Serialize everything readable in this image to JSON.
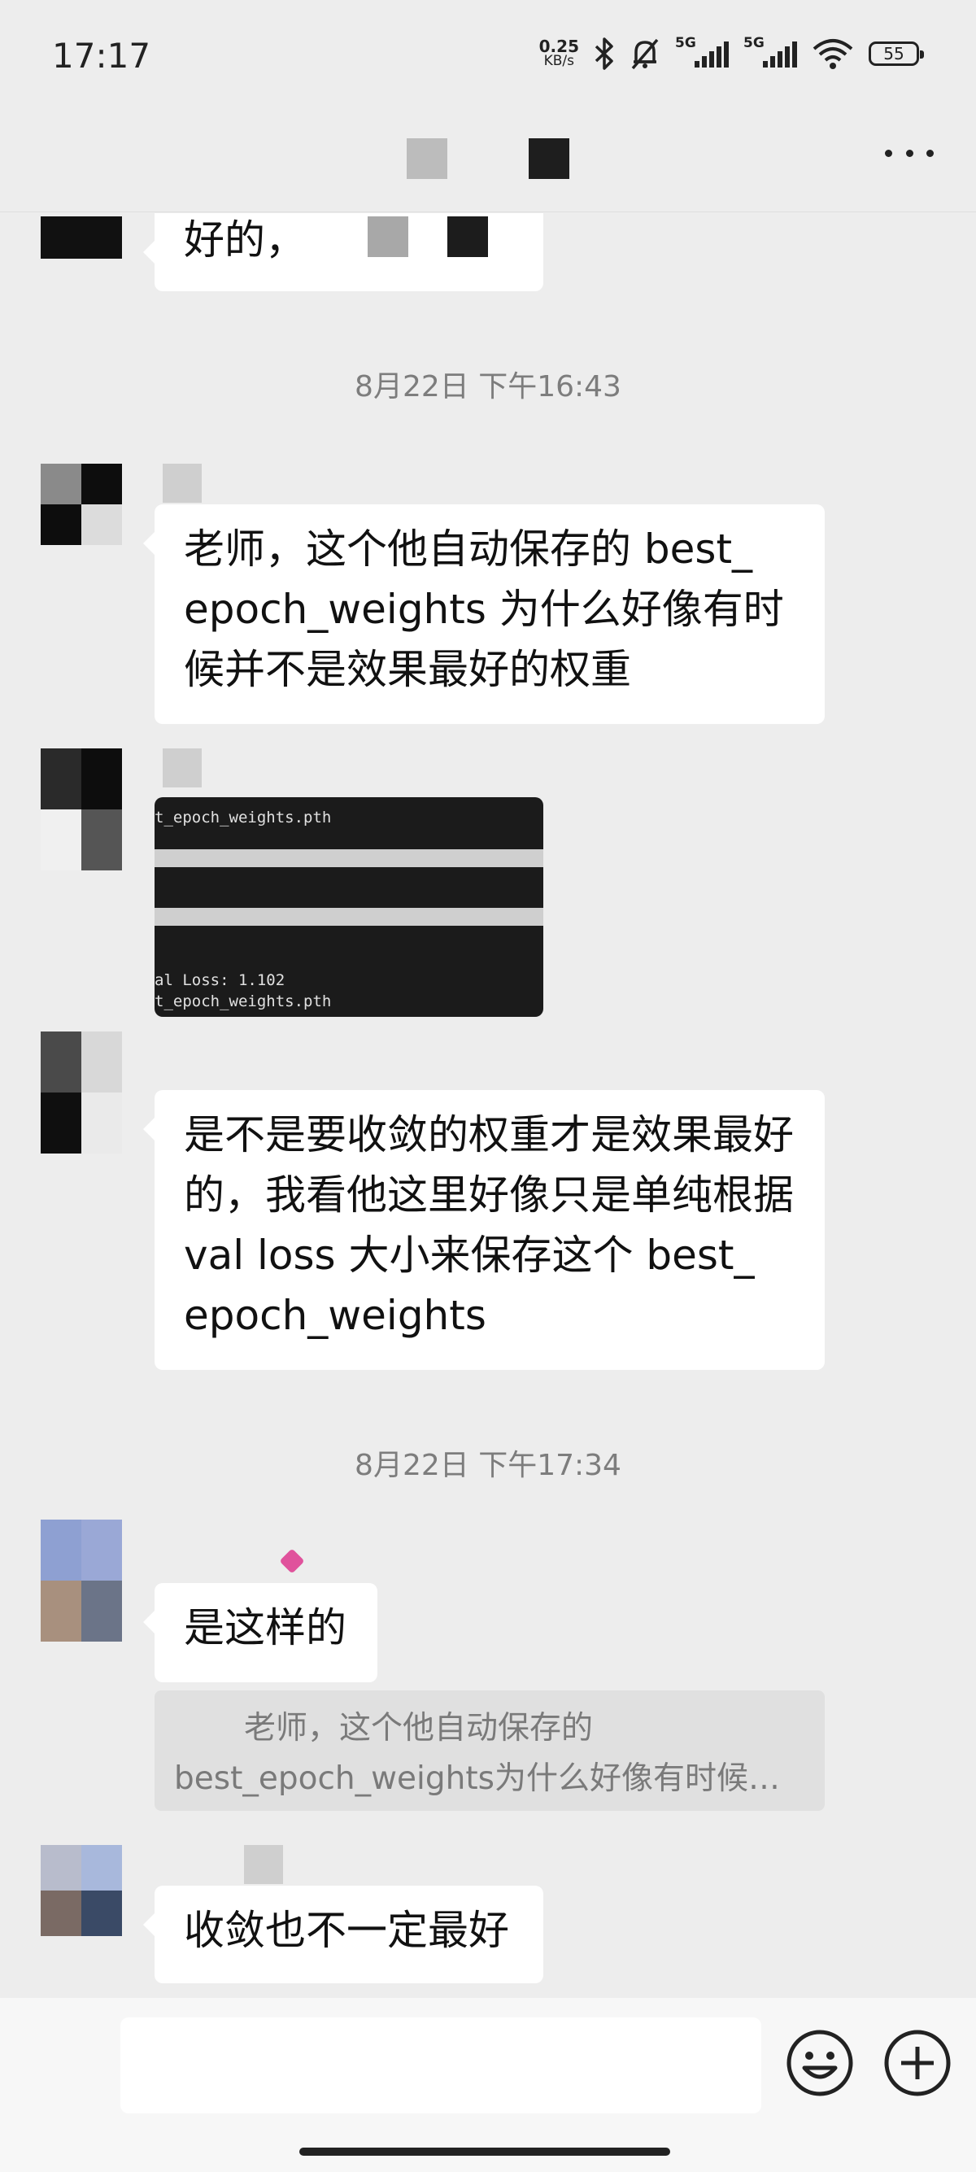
{
  "status_bar": {
    "time": "17:17",
    "net_speed_value": "0.25",
    "net_speed_unit": "KB/s",
    "signal1_label": "5G",
    "signal2_label": "5G",
    "battery": "55"
  },
  "messages": {
    "msg0_text": "好的，",
    "ts1": "8月22日 下午16:43",
    "msg1_text": "老师，这个他自动保存的 best_ epoch_weights 为什么好像有时候并不是效果最好的权重",
    "image_msg": {
      "line1": "t_epoch_weights.pth",
      "line2": "al Loss: 1.102",
      "line3": "t_epoch_weights.pth"
    },
    "msg3_text": "是不是要收敛的权重才是效果最好的，我看他这里好像只是单纯根据val loss 大小来保存这个 best_ epoch_weights",
    "ts2": "8月22日 下午17:34",
    "msg4_text": "是这样的",
    "quote_line1": "老师，这个他自动保存的",
    "quote_line2": "best_epoch_weights为什么好像有时候…",
    "msg5_text": "收敛也不一定最好"
  },
  "icons": {
    "more": "more-icon",
    "emoji": "emoji-icon",
    "plus": "plus-icon",
    "bluetooth": "bluetooth-icon",
    "mute": "bell-off-icon",
    "wifi": "wifi-icon"
  }
}
